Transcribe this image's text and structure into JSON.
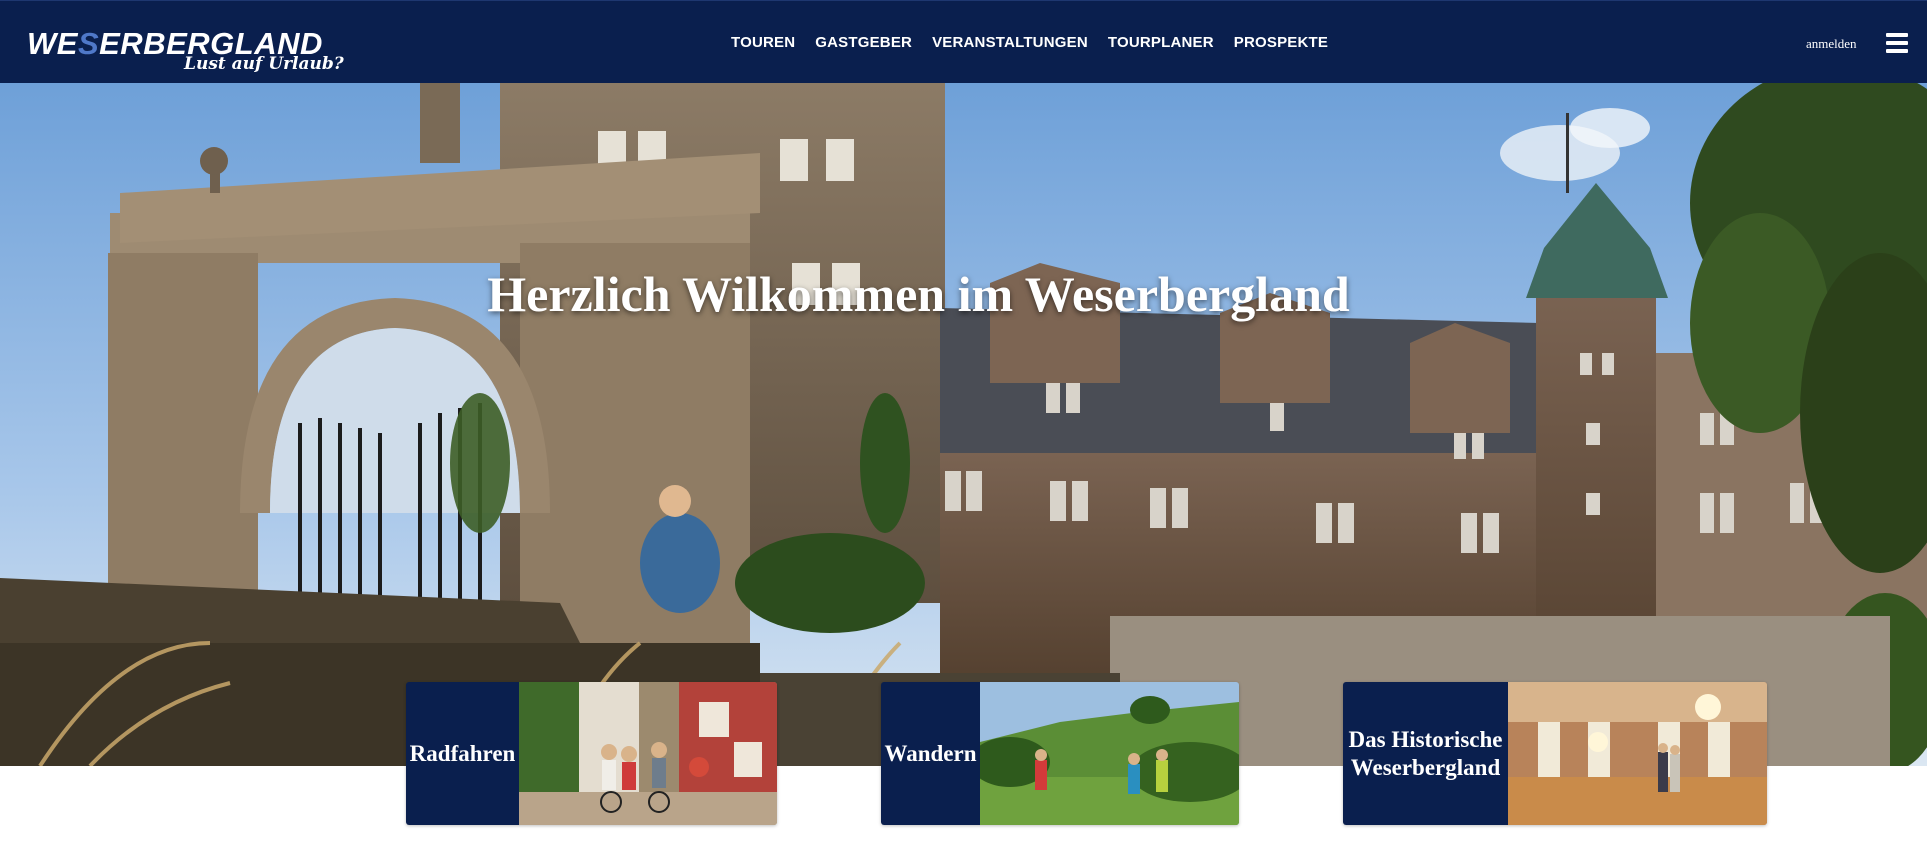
{
  "header": {
    "logo_main_a": "WE",
    "logo_main_b": "S",
    "logo_main_c": "ERBERGLAND",
    "logo_tagline": "Lust auf Urlaub?",
    "nav": [
      "TOUREN",
      "GASTGEBER",
      "VERANSTALTUNGEN",
      "TOURPLANER",
      "PROSPEKTE"
    ],
    "login_label": "anmelden",
    "menu_icon": "hamburger-menu-icon"
  },
  "hero": {
    "title": "Herzlich Wilkommen im Weserbergland"
  },
  "tiles": [
    {
      "label": "Radfahren"
    },
    {
      "label": "Wandern"
    },
    {
      "label": "Das Historische Weserbergland"
    }
  ],
  "colors": {
    "brand_navy": "#0a1f4e",
    "logo_accent": "#4f78c9"
  }
}
